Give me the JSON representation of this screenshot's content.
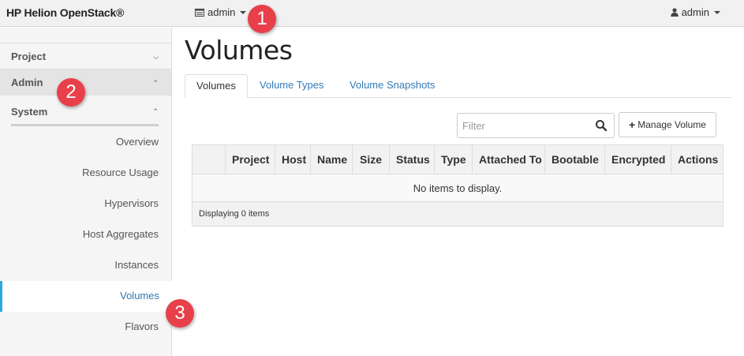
{
  "header": {
    "brand": "HP Helion OpenStack®",
    "project_switcher": "admin",
    "user_menu": "admin"
  },
  "sidebar": {
    "sections": [
      {
        "label": "Project",
        "expanded": false
      },
      {
        "label": "Admin",
        "expanded": true
      }
    ],
    "panel": {
      "label": "System",
      "expanded": true
    },
    "items": [
      {
        "label": "Overview",
        "active": false
      },
      {
        "label": "Resource Usage",
        "active": false
      },
      {
        "label": "Hypervisors",
        "active": false
      },
      {
        "label": "Host Aggregates",
        "active": false
      },
      {
        "label": "Instances",
        "active": false
      },
      {
        "label": "Volumes",
        "active": true
      },
      {
        "label": "Flavors",
        "active": false
      }
    ]
  },
  "main": {
    "title": "Volumes",
    "tabs": [
      {
        "label": "Volumes",
        "active": true
      },
      {
        "label": "Volume Types",
        "active": false
      },
      {
        "label": "Volume Snapshots",
        "active": false
      }
    ],
    "filter_placeholder": "Filter",
    "manage_button": "Manage Volume",
    "table": {
      "columns": [
        "",
        "Project",
        "Host",
        "Name",
        "Size",
        "Status",
        "Type",
        "Attached To",
        "Bootable",
        "Encrypted",
        "Actions"
      ],
      "empty_message": "No items to display.",
      "footer": "Displaying 0 items"
    }
  },
  "markers": [
    "1",
    "2",
    "3"
  ],
  "colors": {
    "link": "#337ab7",
    "active_border": "#2aa8e0",
    "marker": "#e8404a"
  }
}
